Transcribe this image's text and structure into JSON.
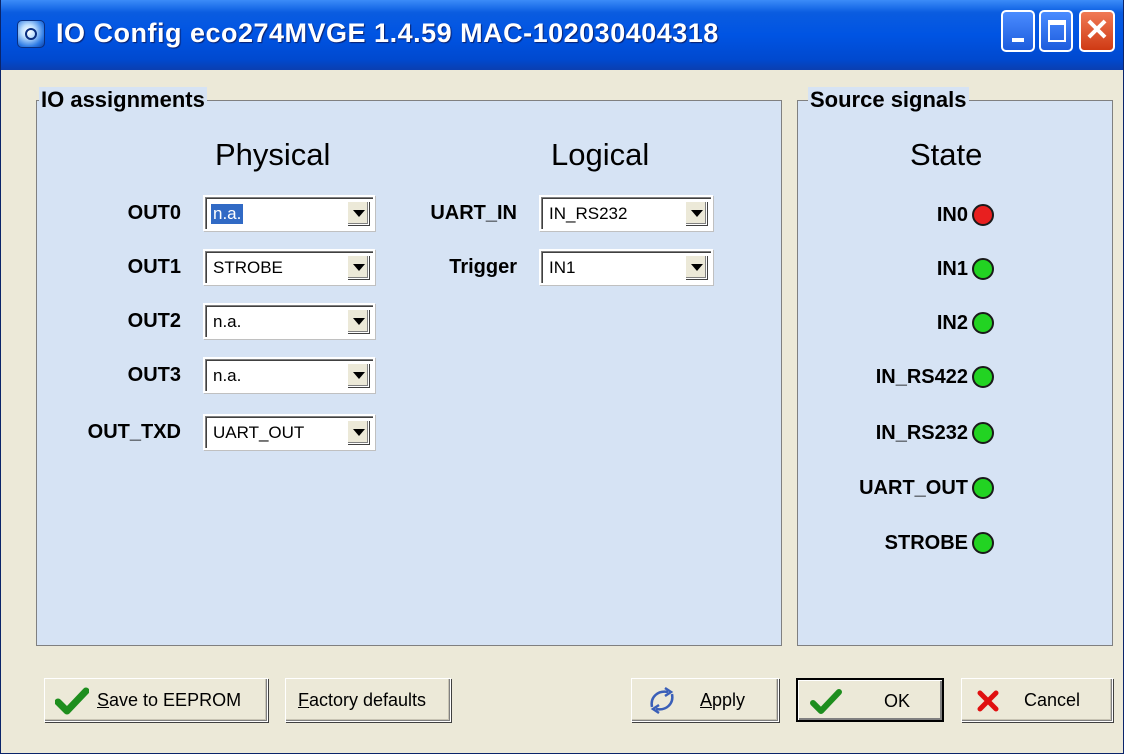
{
  "window": {
    "title": "IO Config eco274MVGE 1.4.59  MAC-102030404318",
    "controls": {
      "minimize": "minimize",
      "maximize": "maximize",
      "close": "✕"
    }
  },
  "io_assignments": {
    "group_title": "IO assignments",
    "physical_header": "Physical",
    "logical_header": "Logical",
    "physical": [
      {
        "label": "OUT0",
        "value": "n.a.",
        "selected": true
      },
      {
        "label": "OUT1",
        "value": "STROBE"
      },
      {
        "label": "OUT2",
        "value": "n.a."
      },
      {
        "label": "OUT3",
        "value": "n.a."
      },
      {
        "label": "OUT_TXD",
        "value": "UART_OUT"
      }
    ],
    "logical": [
      {
        "label": "UART_IN",
        "value": "IN_RS232"
      },
      {
        "label": "Trigger",
        "value": "IN1"
      }
    ]
  },
  "source_signals": {
    "group_title": "Source signals",
    "state_header": "State",
    "signals": [
      {
        "name": "IN0",
        "state_color": "#e81f1f"
      },
      {
        "name": "IN1",
        "state_color": "#22d322"
      },
      {
        "name": "IN2",
        "state_color": "#22d322"
      },
      {
        "name": "IN_RS422",
        "state_color": "#22d322"
      },
      {
        "name": "IN_RS232",
        "state_color": "#22d322"
      },
      {
        "name": "UART_OUT",
        "state_color": "#22d322"
      },
      {
        "name": "STROBE",
        "state_color": "#22d322"
      }
    ]
  },
  "buttons": {
    "save_eeprom": {
      "first": "S",
      "rest": "ave to EEPROM",
      "icon": "checkmark-icon"
    },
    "factory_defaults": {
      "first": "F",
      "rest": "actory defaults"
    },
    "apply": {
      "first": "A",
      "rest": "pply",
      "icon": "apply-arrows-icon"
    },
    "ok": {
      "label": "OK",
      "icon": "checkmark-icon"
    },
    "cancel": {
      "label": "Cancel",
      "icon": "close-x-icon"
    }
  },
  "colors": {
    "panel_bg": "#d6e3f4",
    "titlebar": "#0054e3",
    "led_on": "#22d322",
    "led_alarm": "#e81f1f"
  }
}
